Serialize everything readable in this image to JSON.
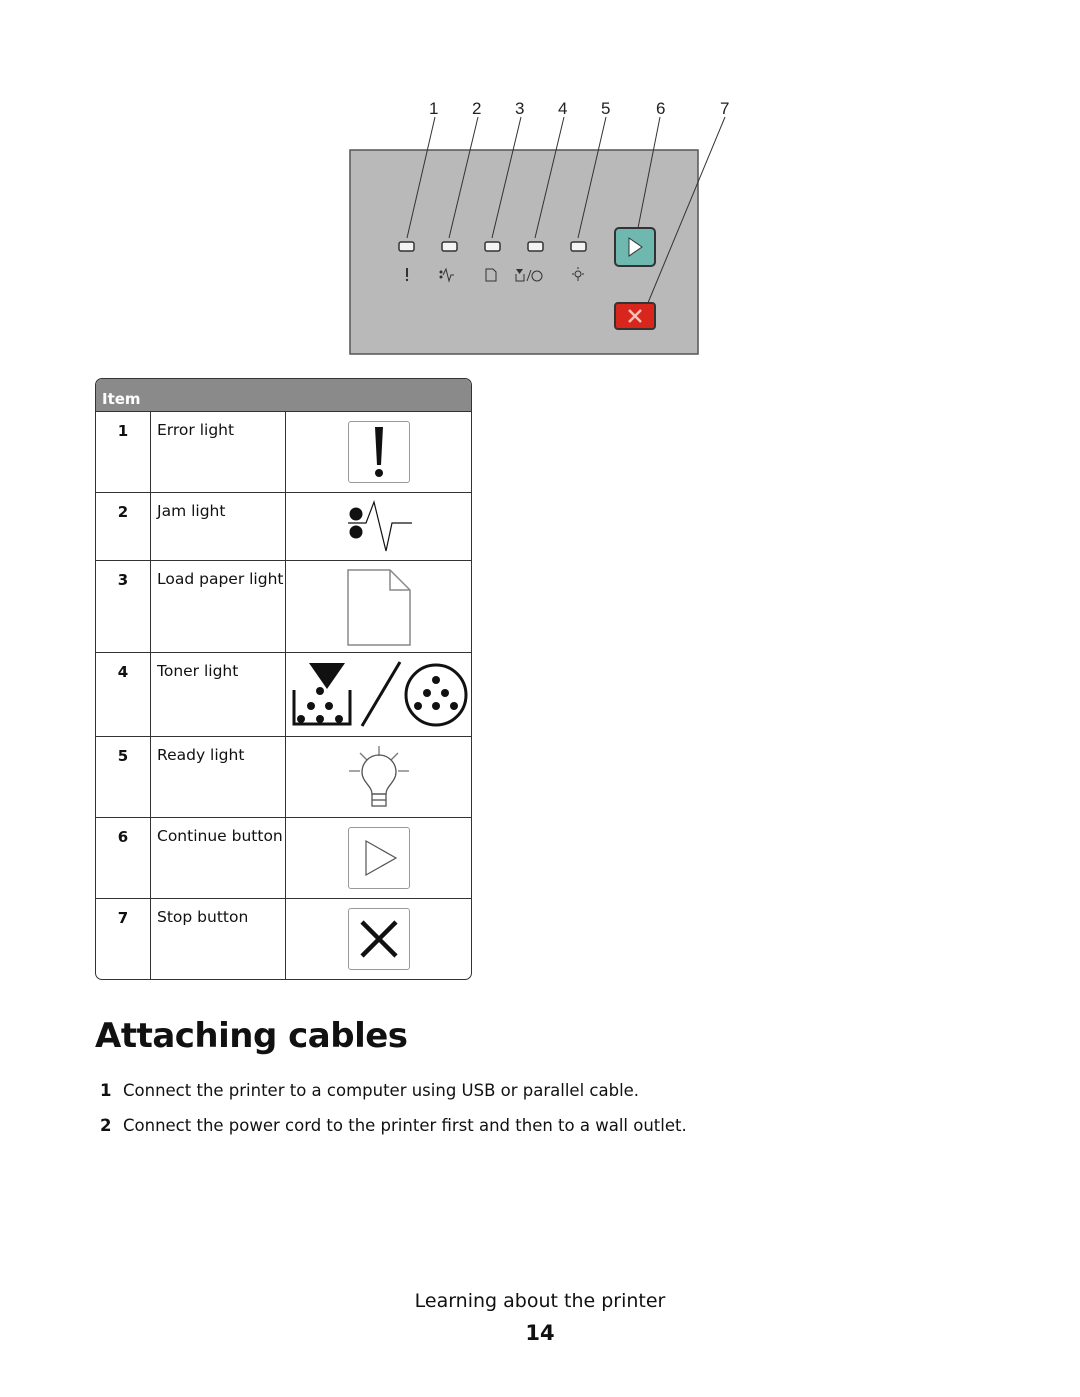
{
  "diagram": {
    "callouts": [
      "1",
      "2",
      "3",
      "4",
      "5",
      "6",
      "7"
    ],
    "panel_color": "#b9b9b9",
    "continue_button_color": "#6fb8b0",
    "stop_button_color": "#d9261c"
  },
  "table": {
    "header": "Item",
    "rows": [
      {
        "num": "1",
        "label": "Error light",
        "icon": "exclamation-icon"
      },
      {
        "num": "2",
        "label": "Jam light",
        "icon": "jam-icon"
      },
      {
        "num": "3",
        "label": "Load paper light",
        "icon": "paper-icon"
      },
      {
        "num": "4",
        "label": "Toner light",
        "icon": "toner-icon"
      },
      {
        "num": "5",
        "label": "Ready light",
        "icon": "lightbulb-icon"
      },
      {
        "num": "6",
        "label": "Continue button",
        "icon": "play-icon"
      },
      {
        "num": "7",
        "label": "Stop button",
        "icon": "x-icon"
      }
    ]
  },
  "section": {
    "title": "Attaching cables",
    "steps": [
      {
        "num": "1",
        "text": "Connect the printer to a computer using USB or parallel cable."
      },
      {
        "num": "2",
        "text": "Connect the power cord to the printer first and then to a wall outlet."
      }
    ]
  },
  "footer": {
    "chapter": "Learning about the printer",
    "page": "14"
  }
}
